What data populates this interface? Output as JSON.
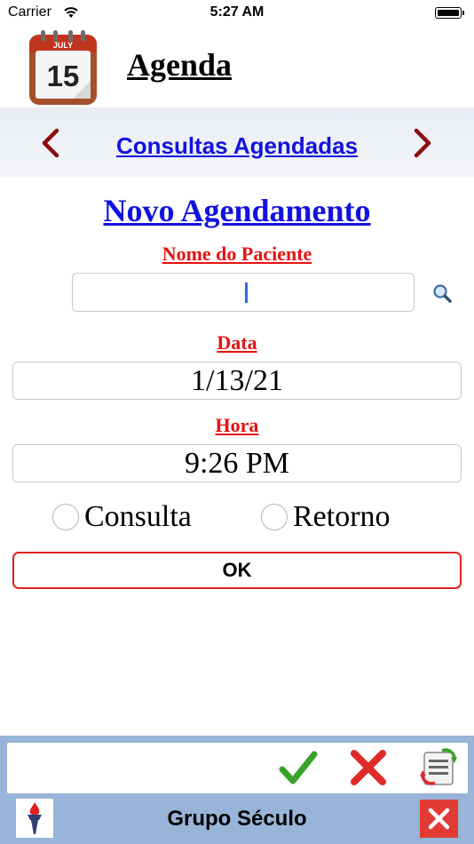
{
  "status_bar": {
    "carrier": "Carrier",
    "time": "5:27 AM",
    "icons": [
      "wifi-icon",
      "battery-icon"
    ]
  },
  "header": {
    "app_title": "Agenda",
    "app_icon": "calendar-icon",
    "icon_month": "JULY",
    "icon_day": "15"
  },
  "navigation": {
    "title": "Consultas Agendadas",
    "prev_icon": "chevron-left-icon",
    "next_icon": "chevron-right-icon"
  },
  "form": {
    "title": "Novo Agendamento",
    "patient_label": "Nome do Paciente",
    "patient_value": "",
    "date_label": "Data",
    "date_value": "1/13/21",
    "time_label": "Hora",
    "time_value": "9:26 PM",
    "type_options": [
      {
        "label": "Consulta",
        "selected": false
      },
      {
        "label": "Retorno",
        "selected": false
      }
    ],
    "ok_label": "OK"
  },
  "toolbar": {
    "icons": [
      "checkmark-icon",
      "x-icon",
      "refresh-list-icon"
    ]
  },
  "footer": {
    "text": "Grupo Século",
    "logo_icon": "torch-icon",
    "close_icon": "close-icon"
  },
  "colors": {
    "link_blue": "#1212e0",
    "label_red": "#e61212",
    "chevron_red": "#8b0e0e",
    "toolbar_blue": "#98b4d8",
    "close_red": "#e23b34",
    "check_green": "#3aa22b"
  }
}
